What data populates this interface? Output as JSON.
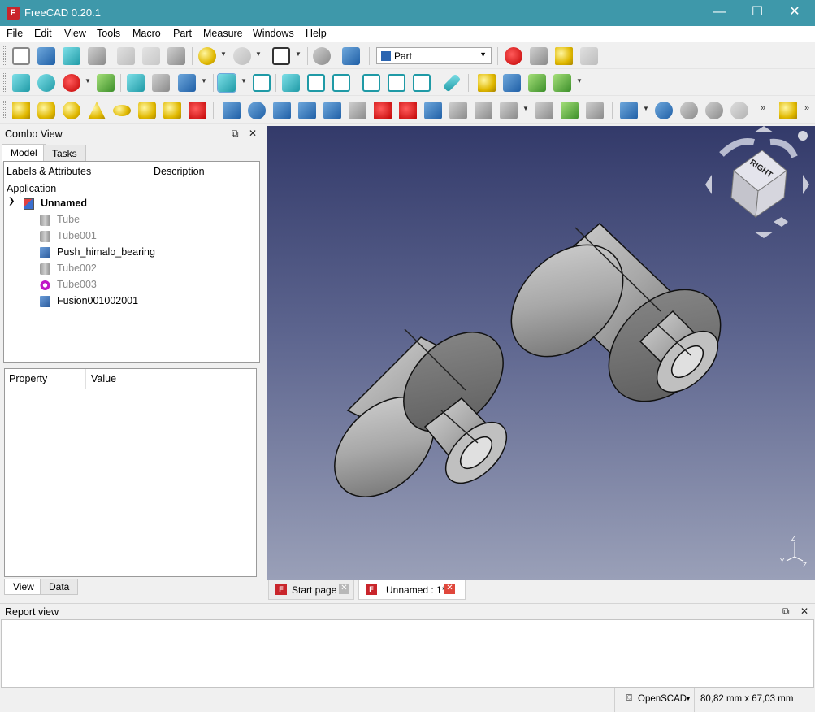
{
  "window": {
    "title": "FreeCAD 0.20.1",
    "minimize": "—",
    "maximize": "☐",
    "close": "✕"
  },
  "menu": [
    "File",
    "Edit",
    "View",
    "Tools",
    "Macro",
    "Part",
    "Measure",
    "Windows",
    "Help"
  ],
  "workbench": {
    "selected": "Part"
  },
  "combo_view": {
    "title": "Combo View",
    "tabs": [
      "Model",
      "Tasks"
    ],
    "tree_columns": [
      "Labels & Attributes",
      "Description"
    ],
    "application_label": "Application",
    "document": "Unnamed",
    "objects": [
      {
        "label": "Tube",
        "icon": "tube-icon",
        "visible": false
      },
      {
        "label": "Tube001",
        "icon": "tube-icon",
        "visible": false
      },
      {
        "label": "Push_himalo_bearing",
        "icon": "solid-icon",
        "visible": true
      },
      {
        "label": "Tube002",
        "icon": "tube-icon",
        "visible": false
      },
      {
        "label": "Tube003",
        "icon": "bearing-icon",
        "visible": false
      },
      {
        "label": "Fusion001002001",
        "icon": "solid-icon",
        "visible": true
      }
    ],
    "property_columns": [
      "Property",
      "Value"
    ],
    "property_tabs": [
      "View",
      "Data"
    ]
  },
  "viewport": {
    "navcube_face": "RIGHT"
  },
  "doc_tabs": [
    {
      "label": "Start page",
      "active": false
    },
    {
      "label": "Unnamed : 1*",
      "active": true
    }
  ],
  "report_view": {
    "title": "Report view"
  },
  "status_bar": {
    "nav_style": "OpenSCAD",
    "dimensions": "80,82 mm x 67,03 mm"
  },
  "colors": {
    "titlebar": "#3e98aa",
    "viewport_top": "#333a6a",
    "viewport_bottom": "#9aa0b8"
  }
}
